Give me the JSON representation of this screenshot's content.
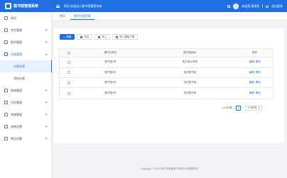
{
  "app": {
    "title": "图书馆管理系统"
  },
  "header": {
    "welcome": "您好,欢迎进入图书馆管理系统",
    "user_greeting": "欢迎您,管理员",
    "logout_label": "退出登录"
  },
  "sidebar": {
    "items": [
      {
        "label": "首页",
        "icon": "home-icon"
      },
      {
        "label": "学生管理",
        "icon": "user-icon"
      },
      {
        "label": "图书管理",
        "icon": "book-icon"
      },
      {
        "label": "分类管理",
        "icon": "folder-icon",
        "open": true,
        "children": [
          {
            "label": "分类列表",
            "active": true
          },
          {
            "label": "添加分类"
          }
        ]
      },
      {
        "label": "借阅管理",
        "icon": "borrow-icon"
      },
      {
        "label": "归还管理",
        "icon": "return-icon"
      },
      {
        "label": "系统管理",
        "icon": "gear-icon"
      },
      {
        "label": "系统设置",
        "icon": "settings-icon"
      },
      {
        "label": "常见问题",
        "icon": "help-icon"
      }
    ]
  },
  "tabs": [
    {
      "label": "首页"
    },
    {
      "label": "图书分类列表",
      "active": true
    }
  ],
  "toolbar": {
    "add_label": "新增",
    "export_label": "导出",
    "import_label": "导入",
    "template_label": "导入模板下载"
  },
  "table": {
    "columns": [
      "图书分类名",
      "图书馆地址",
      "操作"
    ],
    "rows": [
      {
        "name": "图书馆1号",
        "address": "哈尔滨大学城",
        "edit": "编辑",
        "delete": "删除"
      },
      {
        "name": "图书馆2号",
        "address": "测试图书馆",
        "edit": "编辑",
        "delete": "删除"
      },
      {
        "name": "图书馆3号",
        "address": "测试图书馆",
        "edit": "编辑",
        "delete": "删除"
      },
      {
        "name": "图书馆4号",
        "address": "测试图书馆",
        "edit": "编辑",
        "delete": "删除"
      }
    ]
  },
  "pagination": {
    "summary": "1-4 共4条",
    "current_page": "1",
    "page_size": "10 条/页"
  },
  "footer": {
    "text": "Copyright © 2022 哈尔滨某某电子有限公司版权所有"
  },
  "colors": {
    "primary": "#1f6fe0"
  }
}
